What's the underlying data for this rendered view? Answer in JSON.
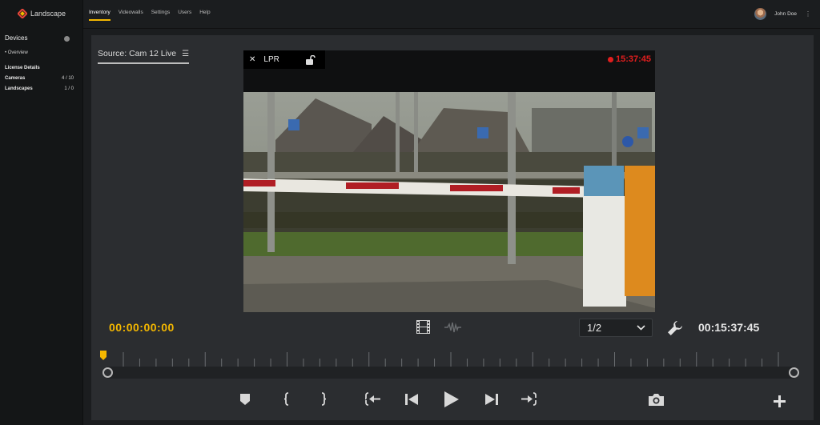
{
  "brand": {
    "name": "Landscape"
  },
  "nav": {
    "items": [
      "Inventory",
      "Videowalls",
      "Settings",
      "Users",
      "Help"
    ],
    "active": "Inventory"
  },
  "user": {
    "name": "John Doe"
  },
  "sidebar": {
    "heading": "Devices",
    "overview": "• Overview",
    "license_heading": "License Details",
    "rows": [
      {
        "label": "Cameras",
        "value": "4 / 10"
      },
      {
        "label": "Landscapes",
        "value": "1 / 0"
      }
    ]
  },
  "source": {
    "label": "Source: Cam 12 Live"
  },
  "viewer": {
    "close": "✕",
    "mode": "LPR",
    "rec_time": "15:37:45"
  },
  "controls": {
    "timecode_start": "00:00:00:00",
    "timecode_end": "00:15:37:45",
    "page": "1/2"
  },
  "icons": {
    "film": "film-strip-icon",
    "wave": "waveform-icon",
    "wrench": "wrench-icon",
    "marker": "bookmark-icon",
    "mark_in": "mark-in-icon",
    "mark_out": "mark-out-icon",
    "go_start": "go-to-start-icon",
    "step_back": "step-back-icon",
    "play": "play-icon",
    "step_forward": "step-forward-icon",
    "go_end": "go-to-end-icon",
    "snapshot": "camera-icon",
    "add": "plus-icon"
  },
  "colors": {
    "accent": "#f5b800",
    "recording": "#e21e1e",
    "panel": "#2b2d30",
    "background": "#1b1d1f"
  }
}
